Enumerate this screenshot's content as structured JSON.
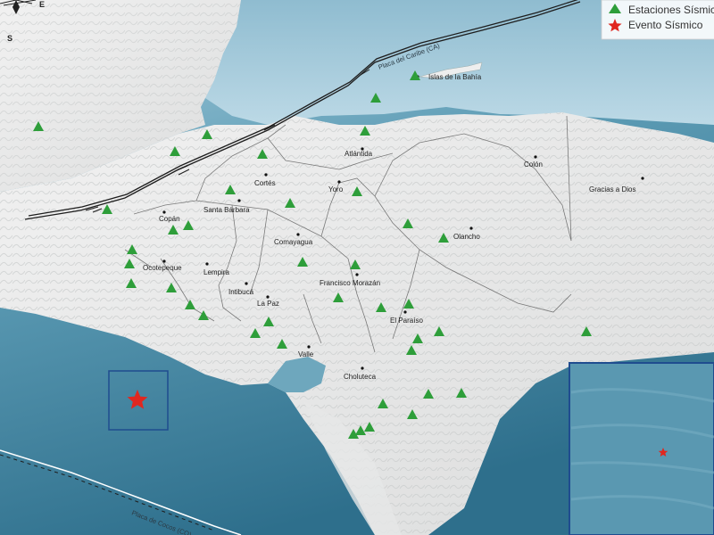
{
  "legend": {
    "stations_label": "Estaciones Sísmicas",
    "event_label": "Evento Sísmico"
  },
  "compass": {
    "south": "S",
    "east": "E"
  },
  "plates": {
    "caribbean": "Placa del Caribe (CA)",
    "cocos": "Placa de Cocos (CO)"
  },
  "places": [
    "Islas de la Bahía",
    "Atlántida",
    "Colón",
    "Cortés",
    "Yoro",
    "Gracias a Dios",
    "Copán",
    "Santa Bárbara",
    "Olancho",
    "Comayagua",
    "Ocotepeque",
    "Lempira",
    "Intibucá",
    "Francisco Morazán",
    "La Paz",
    "El Paraíso",
    "Valle",
    "Choluteca"
  ],
  "colors": {
    "station": "#2e9e3a",
    "event": "#e0271f",
    "ocean_deep": "#4a8ba6",
    "land": "#e9eaea",
    "inset_border": "#1f4c8f"
  },
  "icons": {
    "station": "green-triangle-icon",
    "event": "red-star-icon"
  }
}
